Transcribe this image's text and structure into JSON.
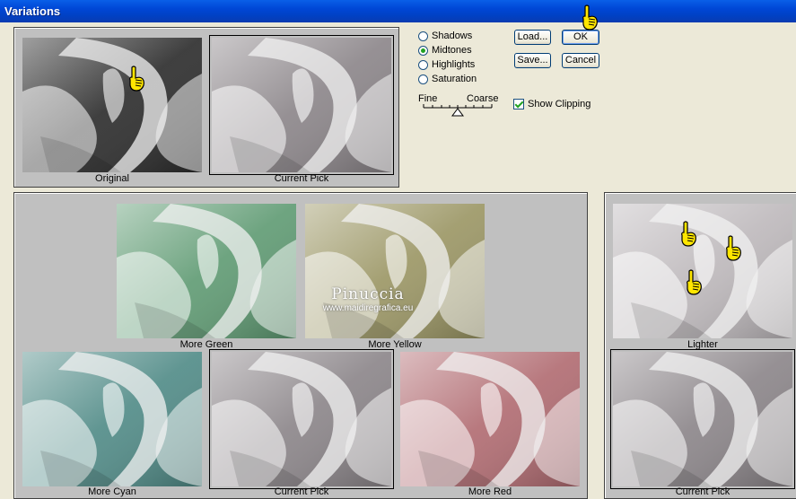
{
  "window": {
    "title": "Variations"
  },
  "modes": [
    {
      "label": "Shadows",
      "selected": false
    },
    {
      "label": "Midtones",
      "selected": true
    },
    {
      "label": "Highlights",
      "selected": false
    },
    {
      "label": "Saturation",
      "selected": false
    }
  ],
  "slider": {
    "left_label": "Fine",
    "right_label": "Coarse",
    "value_fraction": 0.5
  },
  "buttons": {
    "ok": "OK",
    "cancel": "Cancel",
    "load": "Load...",
    "save": "Save..."
  },
  "show_clipping": {
    "label": "Show Clipping",
    "checked": true
  },
  "top_thumbnails": {
    "original": "Original",
    "current": "Current Pick"
  },
  "hue_thumbnails": {
    "more_green": "More Green",
    "more_yellow": "More Yellow",
    "more_cyan": "More Cyan",
    "current": "Current Pick",
    "more_red": "More Red"
  },
  "lightness_thumbnails": {
    "lighter": "Lighter",
    "current": "Current Pick"
  },
  "watermark": {
    "name": "Pinuccia",
    "url": "www.maidiregrafica.eu"
  },
  "colors": {
    "title_bar": "#0046d5",
    "original_tint": "#2a2a2a",
    "green_tint": "#5e9a72",
    "yellow_tint": "#9a9563",
    "cyan_tint": "#4f8a86",
    "red_tint": "#b06a70",
    "neutral_tint": "#8a8488"
  }
}
